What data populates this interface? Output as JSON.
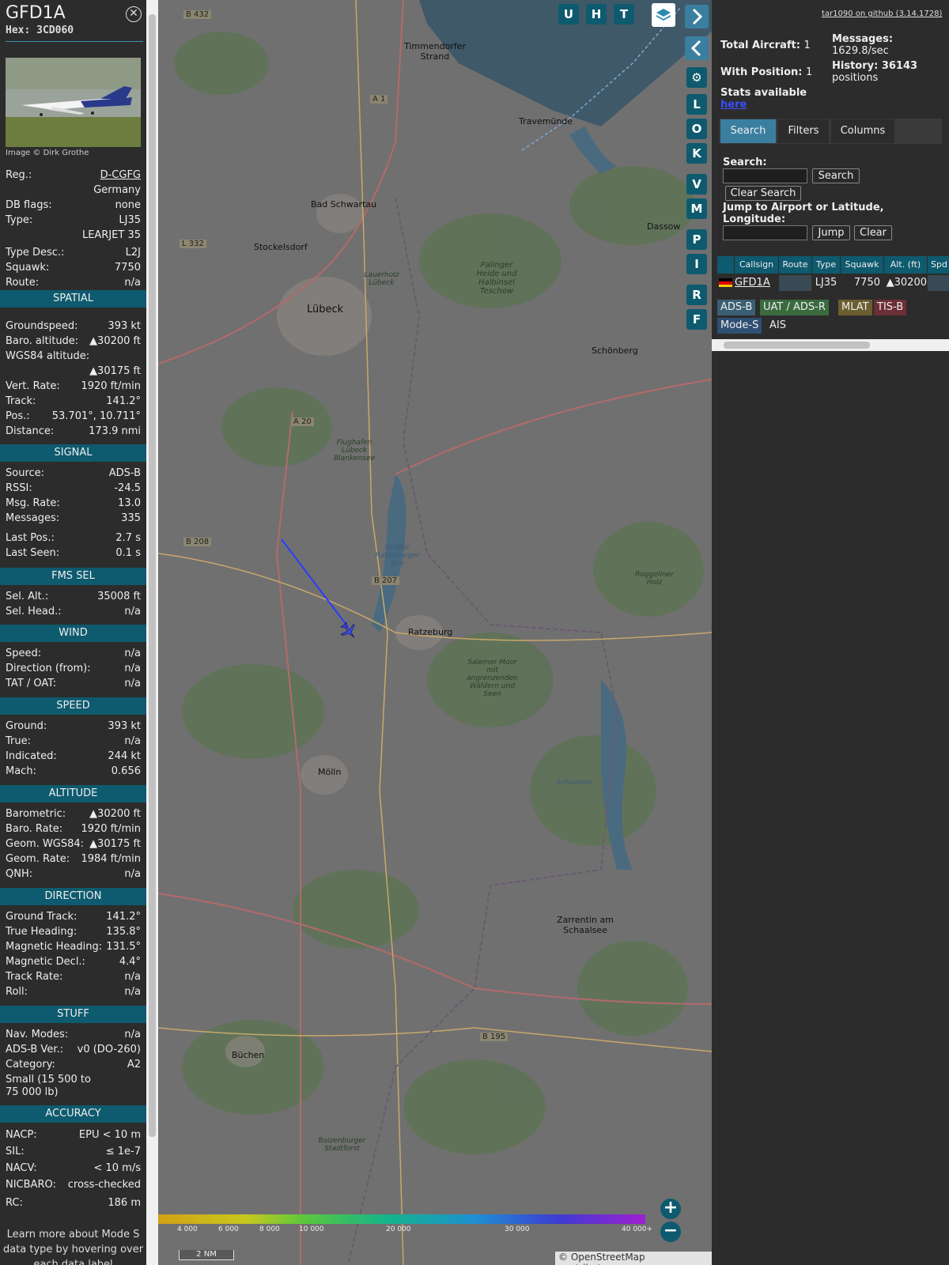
{
  "panel": {
    "title": "GFD1A",
    "hex": "Hex: 3CD060",
    "close_icon": "close-circle-icon",
    "photo_credit": "Image © Dirk Grothe",
    "basic": [
      {
        "k": "Reg.:",
        "v": "D-CGFG"
      },
      {
        "k": "",
        "v": "Germany"
      },
      {
        "k": "DB flags:",
        "v": "none"
      },
      {
        "k": "Type:",
        "v": "LJ35"
      },
      {
        "k": "",
        "v": "LEARJET 35"
      },
      {
        "k": "Type Desc.:",
        "v": "L2J"
      },
      {
        "k": "Squawk:",
        "v": "7750"
      },
      {
        "k": "Route:",
        "v": "n/a"
      }
    ],
    "spatial_title": "SPATIAL",
    "spatial": [
      {
        "k": "Groundspeed:",
        "v": "393 kt"
      },
      {
        "k": "Baro. altitude:",
        "v": "▲30200 ft"
      },
      {
        "k": "WGS84 altitude:",
        "v": ""
      },
      {
        "k": "",
        "v": "▲30175 ft"
      },
      {
        "k": "Vert. Rate:",
        "v": "1920 ft/min"
      },
      {
        "k": "Track:",
        "v": "141.2°"
      },
      {
        "k": "Pos.:",
        "v": "53.701°, 10.711°"
      },
      {
        "k": "Distance:",
        "v": "173.9 nmi"
      }
    ],
    "signal_title": "SIGNAL",
    "signal": [
      {
        "k": "Source:",
        "v": "ADS-B"
      },
      {
        "k": "RSSI:",
        "v": "-24.5"
      },
      {
        "k": "Msg. Rate:",
        "v": "13.0"
      },
      {
        "k": "Messages:",
        "v": "335"
      },
      {
        "k": "Last Pos.:",
        "v": "2.7 s"
      },
      {
        "k": "Last Seen:",
        "v": "0.1 s"
      }
    ],
    "fms_title": "FMS SEL",
    "fms": [
      {
        "k": "Sel. Alt.:",
        "v": "35008 ft"
      },
      {
        "k": "Sel. Head.:",
        "v": "n/a"
      }
    ],
    "wind_title": "WIND",
    "wind": [
      {
        "k": "Speed:",
        "v": "n/a"
      },
      {
        "k": "Direction (from):",
        "v": "n/a"
      },
      {
        "k": "TAT / OAT:",
        "v": "n/a"
      }
    ],
    "speed_title": "SPEED",
    "speed": [
      {
        "k": "Ground:",
        "v": "393 kt"
      },
      {
        "k": "True:",
        "v": "n/a"
      },
      {
        "k": "Indicated:",
        "v": "244 kt"
      },
      {
        "k": "Mach:",
        "v": "0.656"
      }
    ],
    "altitude_title": "ALTITUDE",
    "altitude": [
      {
        "k": "Barometric:",
        "v": "▲30200 ft"
      },
      {
        "k": "Baro. Rate:",
        "v": "1920 ft/min"
      },
      {
        "k": "Geom. WGS84:",
        "v": "▲30175 ft"
      },
      {
        "k": "Geom. Rate:",
        "v": "1984 ft/min"
      },
      {
        "k": "QNH:",
        "v": "n/a"
      }
    ],
    "direction_title": "DIRECTION",
    "direction": [
      {
        "k": "Ground Track:",
        "v": "141.2°"
      },
      {
        "k": "True Heading:",
        "v": "135.8°"
      },
      {
        "k": "Magnetic Heading:",
        "v": "131.5°"
      },
      {
        "k": "Magnetic Decl.:",
        "v": "4.4°"
      },
      {
        "k": "Track Rate:",
        "v": "n/a"
      },
      {
        "k": "Roll:",
        "v": "n/a"
      }
    ],
    "stuff_title": "STUFF",
    "stuff": [
      {
        "k": "Nav. Modes:",
        "v": "n/a"
      },
      {
        "k": "ADS-B Ver.:",
        "v": "v0 (DO-260)"
      },
      {
        "k": "Category:",
        "v": "A2"
      }
    ],
    "category_desc_1": "Small (15 500 to",
    "category_desc_2": "75 000 lb)",
    "accuracy_title": "ACCURACY",
    "accuracy": [
      {
        "k": "NACP:",
        "v": "EPU < 10 m"
      },
      {
        "k": "SIL:",
        "v": "≤ 1e-7"
      },
      {
        "k": "NACV:",
        "v": "< 10 m/s"
      },
      {
        "k": "NICBARO:",
        "v": "cross-checked"
      },
      {
        "k": "RC:",
        "v": "186 m"
      }
    ],
    "learn_1": "Learn more about Mode S",
    "learn_2": "data type by hovering over",
    "learn_3": "each data label"
  },
  "map": {
    "toolbar_top": [
      "U",
      "H",
      "T"
    ],
    "layers_icon": "layers-icon",
    "expand_icon": "chevron-right-icon",
    "collapse_icon": "chevron-left-icon",
    "fullscreen_icon": "split-arrows-icon",
    "settings_icon": "gear-icon",
    "side_buttons": [
      "L",
      "O",
      "K",
      "V",
      "M",
      "P",
      "I",
      "R",
      "F"
    ],
    "labels": [
      "B 432",
      "Timmendorfer Strand",
      "Travemünde",
      "Bad Schwartau",
      "Stockelsdorf",
      "Lübeck",
      "Dassow",
      "Schönberg",
      "Flughafen Lübeck Blankensee",
      "B 208",
      "B 207",
      "Ratzeburg",
      "Mölln",
      "Zarrentin am Schaalsee",
      "Büchen",
      "B 195",
      "Boizenburger Stadtforst",
      "Schaalsee",
      "A 1",
      "A 20",
      "L 332",
      "Palinger Heide und Halbinsel Teschow",
      "Lauerholz Lübeck",
      "Salemer Moor mit angrenzenden Wäldern und Seen",
      "Großer Ratzeburger See",
      "Roggeliner Holz"
    ],
    "altitude_ticks": [
      "4 000",
      "6 000",
      "8 000",
      "10 000",
      "20 000",
      "30 000",
      "40 000+"
    ],
    "scale": "2 NM",
    "attribution": "© OpenStreetMap contributors.",
    "zoom_in_icon": "plus-icon",
    "zoom_out_icon": "minus-icon",
    "aircraft_icon": "airplane-icon"
  },
  "right": {
    "github": "tar1090 on github (3.14.1728)",
    "total_label": "Total Aircraft:",
    "total_value": "1",
    "messages_label": "Messages:",
    "messages_value": "1629.8/sec",
    "withpos_label": "With Position:",
    "withpos_value": "1",
    "history_label": "History: 36143",
    "history_value": "positions",
    "stats_label": "Stats available",
    "stats_link": "here",
    "tabs": [
      "Search",
      "Filters",
      "Columns"
    ],
    "search_label": "Search:",
    "search_button": "Search",
    "clear_search_button": "Clear Search",
    "jump_label": "Jump to Airport or Latitude, Longitude:",
    "jump_button": "Jump",
    "clear_button": "Clear",
    "columns": [
      "Callsign",
      "Route",
      "Type",
      "Squawk",
      "Alt. (ft)",
      "Spd"
    ],
    "rows": [
      {
        "callsign": "GFD1A",
        "route": "",
        "type": "LJ35",
        "squawk": "7750",
        "alt": "▲30200",
        "flag_icon": "germany-flag-icon"
      }
    ],
    "chips": [
      {
        "label": "ADS-B",
        "color": "#3a5f73"
      },
      {
        "label": "UAT / ADS-R",
        "color": "#3a6b3f"
      },
      {
        "label": "MLAT",
        "color": "#6b5e2f"
      },
      {
        "label": "TIS-B",
        "color": "#6b2f38"
      },
      {
        "label": "Mode-S",
        "color": "#2f4f73"
      },
      {
        "label": "AIS",
        "color": "#2c2c2c"
      }
    ]
  },
  "colors": {
    "section": "#0e5a6e",
    "panel_bg": "#2c2c2c",
    "track": "#2b3bff",
    "aircraft": "#3b4ee8"
  }
}
